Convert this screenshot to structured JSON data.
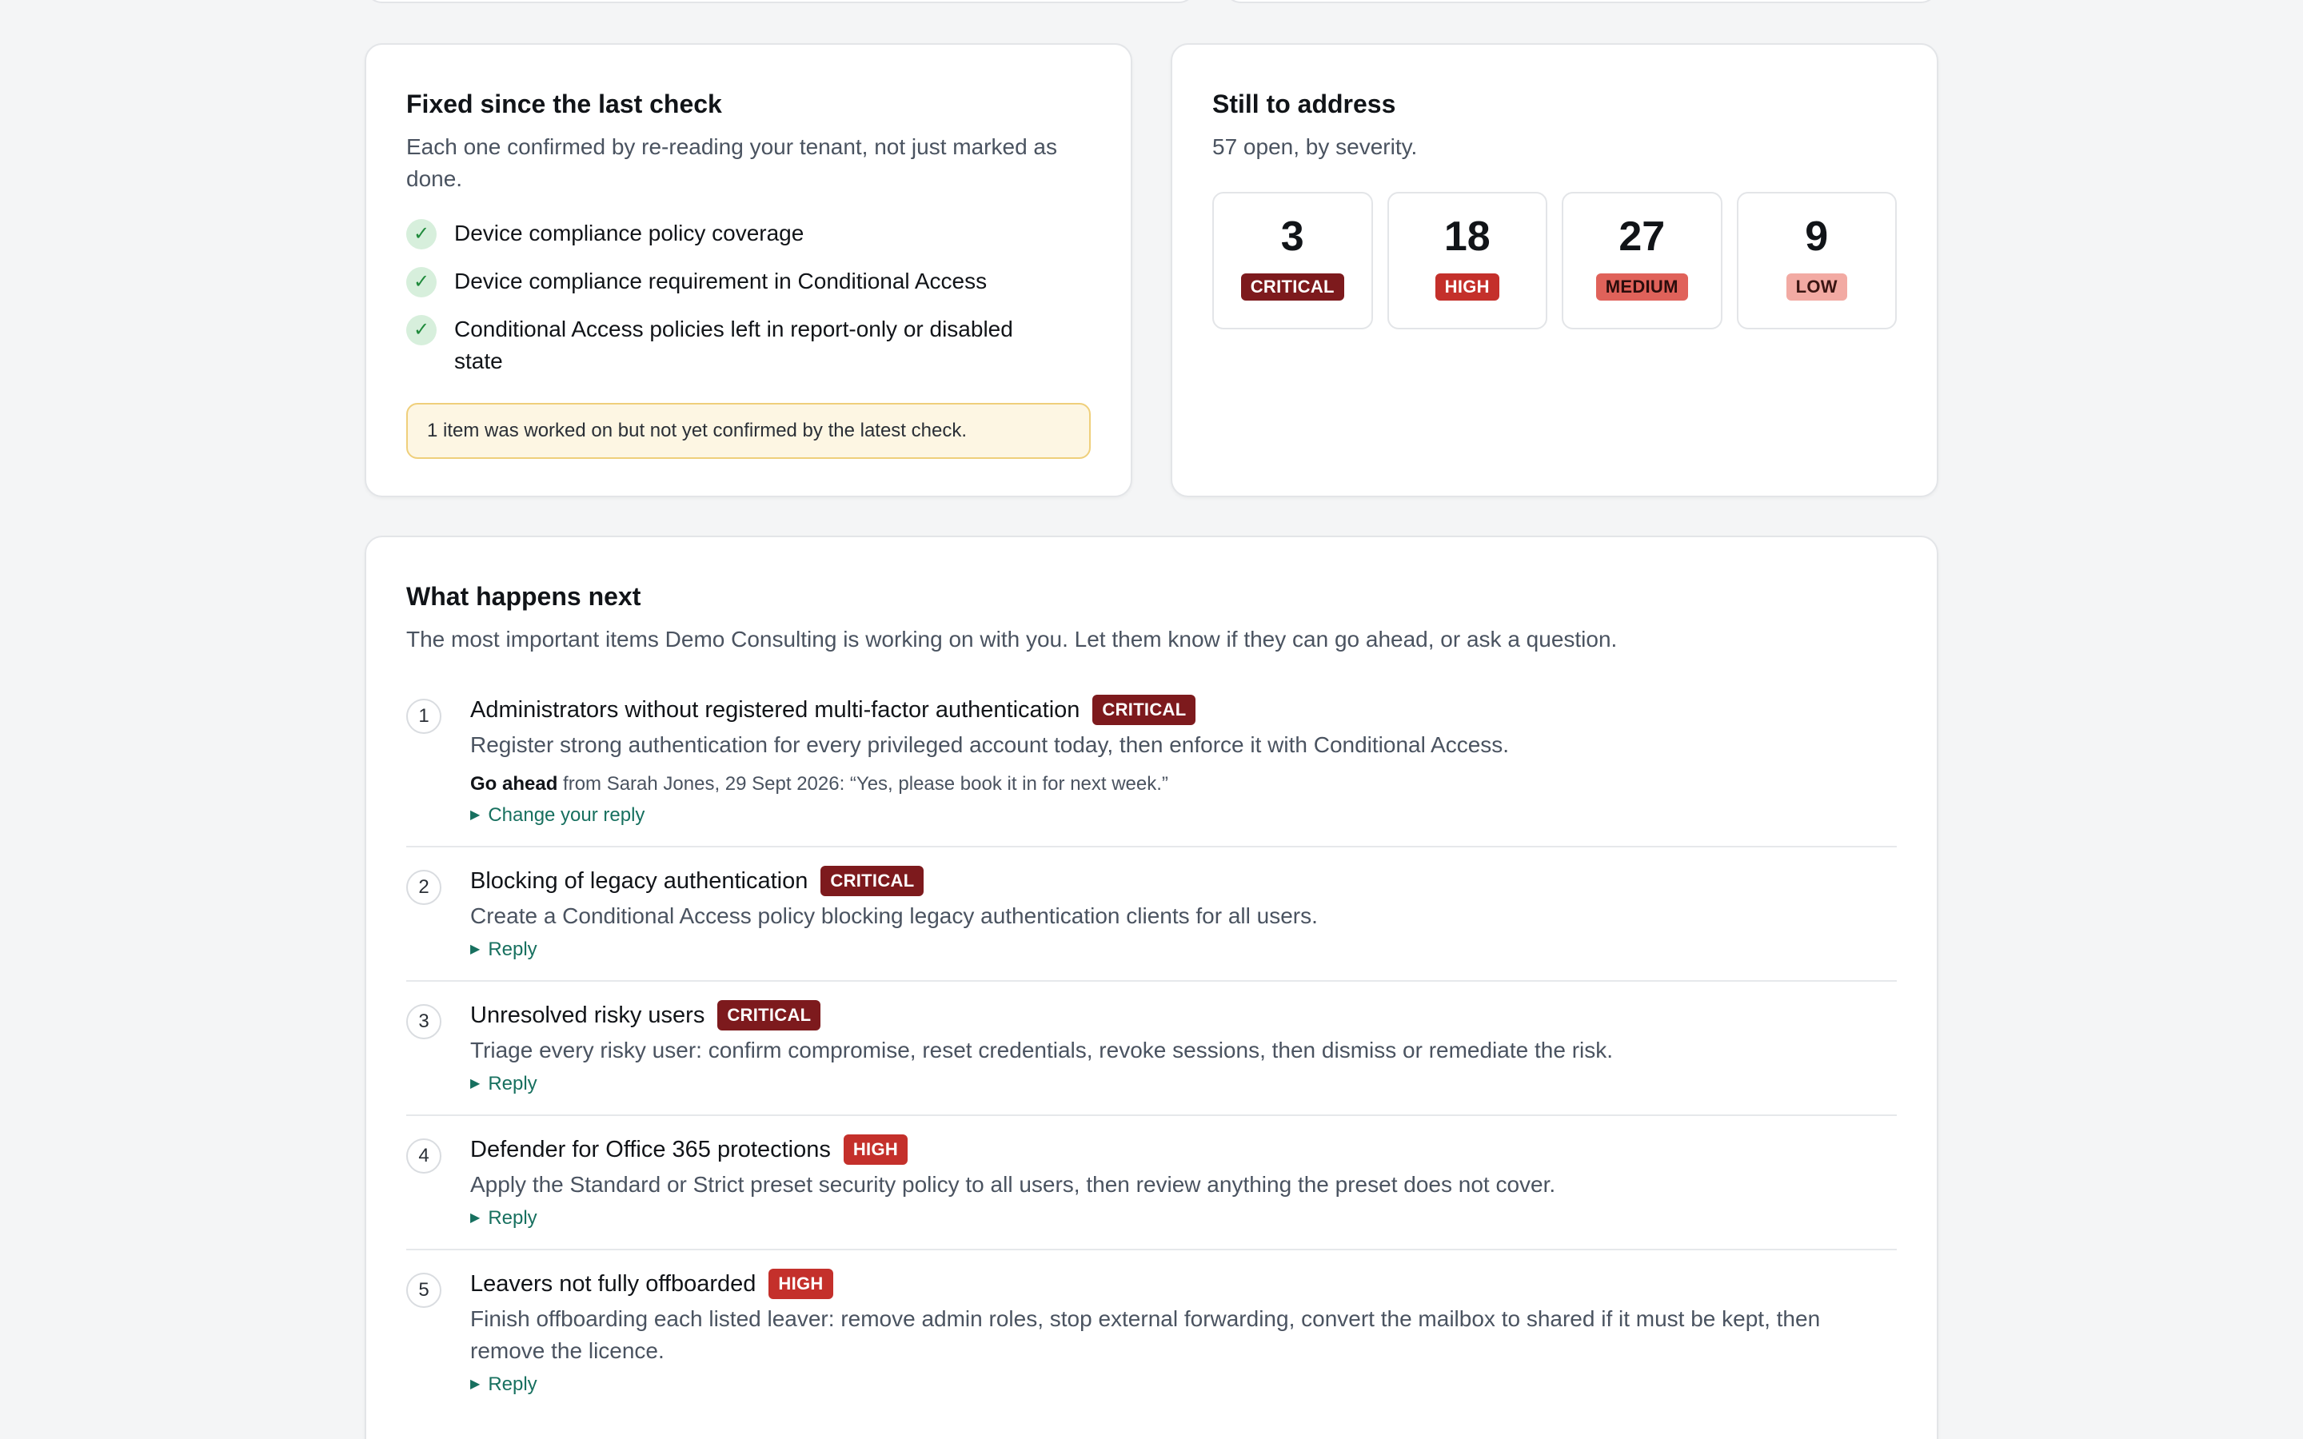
{
  "fixed": {
    "title": "Fixed since the last check",
    "subtitle": "Each one confirmed by re-reading your tenant, not just marked as done.",
    "items": [
      "Device compliance policy coverage",
      "Device compliance requirement in Conditional Access",
      "Conditional Access policies left in report-only or disabled state"
    ],
    "notice": "1 item was worked on but not yet confirmed by the latest check."
  },
  "still": {
    "title": "Still to address",
    "subtitle": "57 open, by severity.",
    "severities": [
      {
        "count": "3",
        "label": "CRITICAL"
      },
      {
        "count": "18",
        "label": "HIGH"
      },
      {
        "count": "27",
        "label": "MEDIUM"
      },
      {
        "count": "9",
        "label": "LOW"
      }
    ]
  },
  "next": {
    "title": "What happens next",
    "subtitle": "The most important items Demo Consulting is working on with you. Let them know if they can go ahead, or ask a question.",
    "items": [
      {
        "num": "1",
        "title": "Administrators without registered multi-factor authentication",
        "severity": "CRITICAL",
        "desc": "Register strong authentication for every privileged account today, then enforce it with Conditional Access.",
        "reply_status": "Go ahead",
        "reply_text": " from Sarah Jones, 29 Sept 2026: “Yes, please book it in for next week.”",
        "link": "Change your reply"
      },
      {
        "num": "2",
        "title": "Blocking of legacy authentication",
        "severity": "CRITICAL",
        "desc": "Create a Conditional Access policy blocking legacy authentication clients for all users.",
        "link": "Reply"
      },
      {
        "num": "3",
        "title": "Unresolved risky users",
        "severity": "CRITICAL",
        "desc": "Triage every risky user: confirm compromise, reset credentials, revoke sessions, then dismiss or remediate the risk.",
        "link": "Reply"
      },
      {
        "num": "4",
        "title": "Defender for Office 365 protections",
        "severity": "HIGH",
        "desc": "Apply the Standard or Strict preset security policy to all users, then review anything the preset does not cover.",
        "link": "Reply"
      },
      {
        "num": "5",
        "title": "Leavers not fully offboarded",
        "severity": "HIGH",
        "desc": "Finish offboarding each listed leaver: remove admin roles, stop external forwarding, convert the mailbox to shared if it must be kept, then remove the licence.",
        "link": "Reply"
      }
    ]
  }
}
